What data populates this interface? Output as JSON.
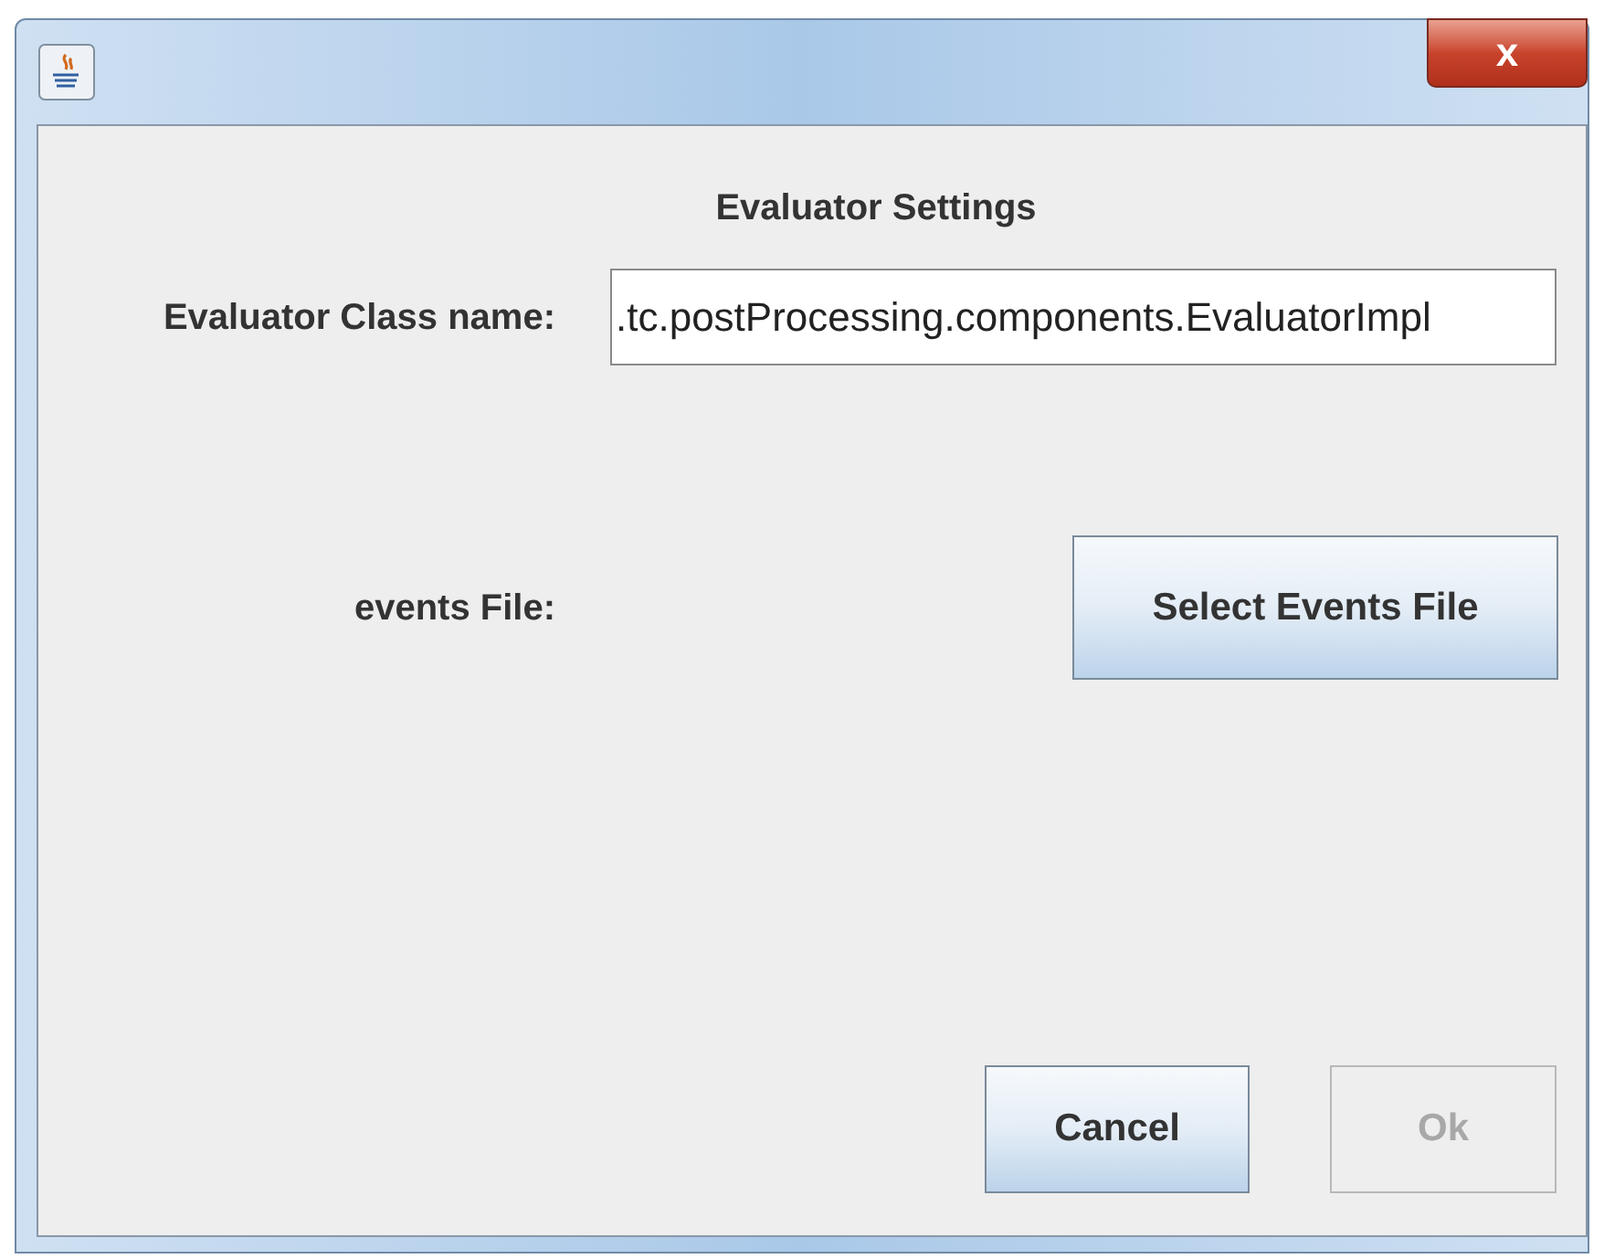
{
  "window": {
    "close_label": "x"
  },
  "heading": "Evaluator Settings",
  "class_name": {
    "label": "Evaluator Class name:",
    "value": ".tc.postProcessing.components.EvaluatorImpl"
  },
  "events_file": {
    "label": "events File:",
    "button": "Select Events File"
  },
  "buttons": [
    {
      "label": "Cancel",
      "disabled": false
    },
    {
      "label": "Ok",
      "disabled": true
    }
  ]
}
